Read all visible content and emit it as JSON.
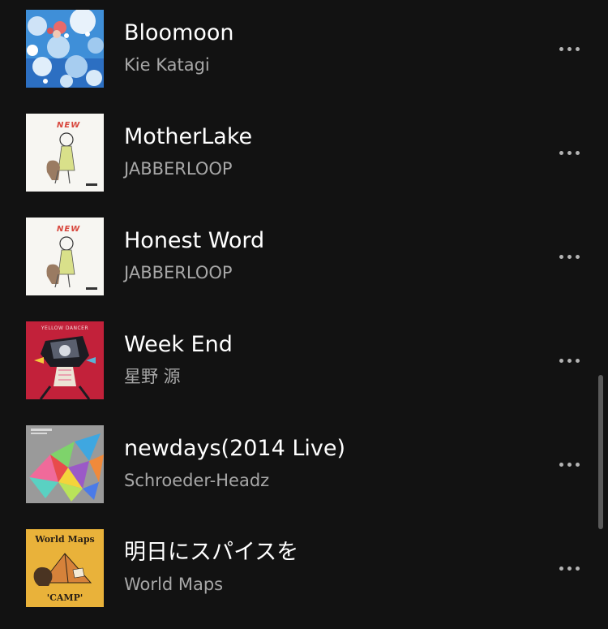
{
  "tracks": [
    {
      "title": "Bloomoon",
      "artist": "Kie Katagi",
      "art_icon": "bloomoon-cover"
    },
    {
      "title": "MotherLake",
      "artist": "JABBERLOOP",
      "art_icon": "new-cover",
      "art_text": "NEW"
    },
    {
      "title": "Honest Word",
      "artist": "JABBERLOOP",
      "art_icon": "new-cover",
      "art_text": "NEW"
    },
    {
      "title": "Week End",
      "artist": "星野 源",
      "art_icon": "yellow-dancer-cover",
      "art_text": "YELLOW DANCER"
    },
    {
      "title": "newdays(2014 Live)",
      "artist": "Schroeder-Headz",
      "art_icon": "geometric-cover"
    },
    {
      "title": "明日にスパイスを",
      "artist": "World Maps",
      "art_icon": "camp-cover",
      "art_text": "World Maps",
      "art_subtext": "'CAMP'"
    }
  ],
  "more_icon": "more-horizontal-icon",
  "colors": {
    "background": "#121212",
    "title": "#ffffff",
    "artist": "#a7a7a7",
    "more_dots": "#b3b3b3",
    "scrollbar": "#5a5a5a"
  }
}
